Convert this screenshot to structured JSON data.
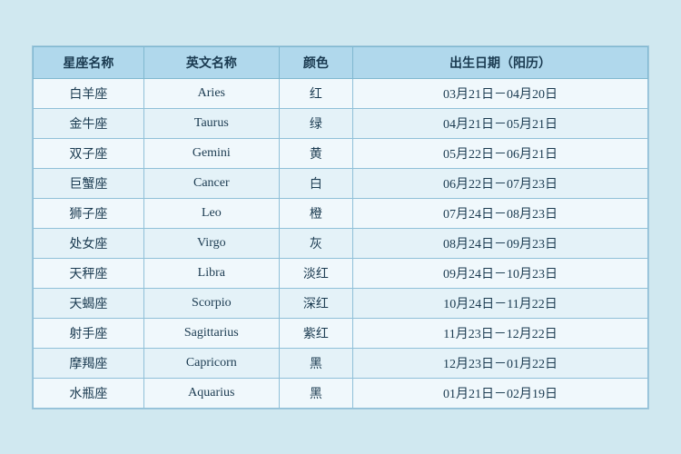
{
  "table": {
    "headers": [
      {
        "key": "chinese_name",
        "label": "星座名称"
      },
      {
        "key": "english_name",
        "label": "英文名称"
      },
      {
        "key": "color",
        "label": "颜色"
      },
      {
        "key": "date_range",
        "label": "出生日期（阳历）"
      }
    ],
    "rows": [
      {
        "chinese": "白羊座",
        "english": "Aries",
        "color": "红",
        "date": "03月21日－04月20日"
      },
      {
        "chinese": "金牛座",
        "english": "Taurus",
        "color": "绿",
        "date": "04月21日－05月21日"
      },
      {
        "chinese": "双子座",
        "english": "Gemini",
        "color": "黄",
        "date": "05月22日－06月21日"
      },
      {
        "chinese": "巨蟹座",
        "english": "Cancer",
        "color": "白",
        "date": "06月22日－07月23日"
      },
      {
        "chinese": "狮子座",
        "english": "Leo",
        "color": "橙",
        "date": "07月24日－08月23日"
      },
      {
        "chinese": "处女座",
        "english": "Virgo",
        "color": "灰",
        "date": "08月24日－09月23日"
      },
      {
        "chinese": "天秤座",
        "english": "Libra",
        "color": "淡红",
        "date": "09月24日－10月23日"
      },
      {
        "chinese": "天蝎座",
        "english": "Scorpio",
        "color": "深红",
        "date": "10月24日－11月22日"
      },
      {
        "chinese": "射手座",
        "english": "Sagittarius",
        "color": "紫红",
        "date": "11月23日－12月22日"
      },
      {
        "chinese": "摩羯座",
        "english": "Capricorn",
        "color": "黑",
        "date": "12月23日－01月22日"
      },
      {
        "chinese": "水瓶座",
        "english": "Aquarius",
        "color": "黑",
        "date": "01月21日－02月19日"
      }
    ]
  }
}
